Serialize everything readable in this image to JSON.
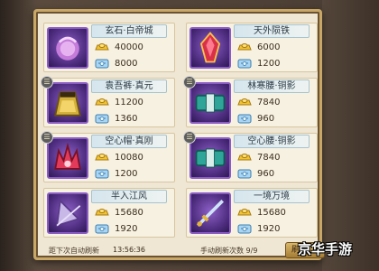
{
  "items": [
    {
      "name": "玄石·白帝城",
      "gold": "40000",
      "silver": "8000",
      "art": "orb",
      "tier_badge": false
    },
    {
      "name": "天外陨铁",
      "gold": "6000",
      "silver": "1200",
      "art": "crystal",
      "tier_badge": false
    },
    {
      "name": "袁吾裤·真元",
      "gold": "11200",
      "silver": "1360",
      "art": "skirt",
      "tier_badge": true
    },
    {
      "name": "林寒腰·铜影",
      "gold": "7840",
      "silver": "960",
      "art": "belt",
      "tier_badge": true
    },
    {
      "name": "空心帽·真刚",
      "gold": "10080",
      "silver": "1200",
      "art": "crown",
      "tier_badge": true
    },
    {
      "name": "空心腰·铜影",
      "gold": "7840",
      "silver": "960",
      "art": "belt",
      "tier_badge": true
    },
    {
      "name": "半入江风",
      "gold": "15680",
      "silver": "1920",
      "art": "fan",
      "tier_badge": false
    },
    {
      "name": "一境万境",
      "gold": "15680",
      "silver": "1920",
      "art": "sword",
      "tier_badge": false
    }
  ],
  "footer": {
    "next_refresh_label": "距下次自动刷新",
    "next_refresh_time": "13:56:36",
    "manual_refresh_label": "手动刷新次数 9/9",
    "refresh_button_label": "刷"
  },
  "watermark": "京华手游",
  "colors": {
    "panel_bg": "#efe6d3",
    "frame_purple": "#8a5cc4",
    "gold_border": "#c9a867"
  }
}
